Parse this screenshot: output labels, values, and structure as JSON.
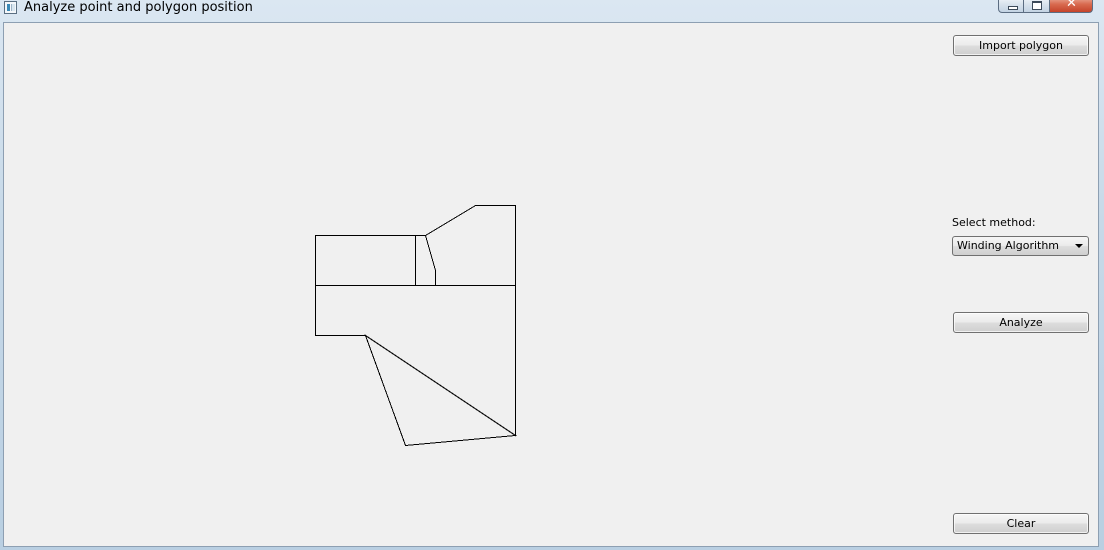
{
  "window": {
    "title": "Analyze point and polygon position",
    "icon": "app-window-icon",
    "controls": {
      "minimize_icon": "minimize-icon",
      "maximize_icon": "maximize-icon",
      "close_glyph": "✕"
    }
  },
  "sidebar": {
    "import_button": "Import polygon",
    "method_label": "Select method:",
    "method_select": {
      "value": "Winding Algorithm"
    },
    "analyze_button": "Analyze",
    "clear_button": "Clear"
  },
  "colors": {
    "client_background": "#f0f0f0",
    "polygon_stroke": "#000000",
    "close_button": "#c4432a"
  }
}
